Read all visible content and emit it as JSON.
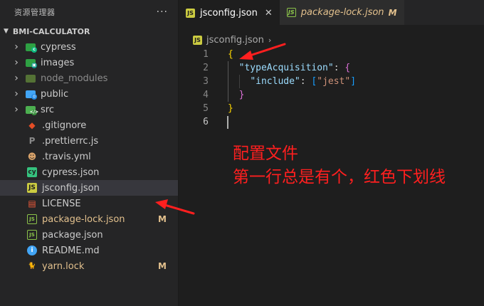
{
  "sidebar": {
    "title": "资源管理器",
    "more": "···",
    "section": "BMI-CALCULATOR",
    "items": [
      {
        "label": "cypress",
        "kind": "folder",
        "icon": "cypress-folder-icon",
        "color": "#2ea043",
        "mini": "c",
        "mini_color": "#10b981",
        "dim": false
      },
      {
        "label": "images",
        "kind": "folder",
        "icon": "images-folder-icon",
        "color": "#2ea043",
        "mini": "▣",
        "mini_color": "#0d9488",
        "dim": false
      },
      {
        "label": "node_modules",
        "kind": "folder",
        "icon": "node-modules-folder-icon",
        "color": "#7cb342",
        "mini": "",
        "mini_color": "#8bc34a",
        "dim": true
      },
      {
        "label": "public",
        "kind": "folder",
        "icon": "public-folder-icon",
        "color": "#42a5f5",
        "mini": "◎",
        "mini_color": "#1e88e5",
        "dim": false
      },
      {
        "label": "src",
        "kind": "folder",
        "icon": "src-folder-icon",
        "color": "#4caf50",
        "mini": "</>",
        "mini_color": "#388e3c",
        "dim": false
      },
      {
        "label": ".gitignore",
        "kind": "file",
        "icon": "git-icon",
        "glyph": "◆",
        "color": "#e44d26",
        "fg": "#e44d26",
        "bg": "transparent"
      },
      {
        "label": ".prettierrc.js",
        "kind": "file",
        "icon": "prettier-icon",
        "glyph": "P",
        "color": "#8a8a8a",
        "fg": "#8a8a8a",
        "bg": "transparent"
      },
      {
        "label": ".travis.yml",
        "kind": "file",
        "icon": "travis-icon",
        "glyph": "☻",
        "color": "#cd5c3a",
        "fg": "#d9a36a",
        "bg": "transparent"
      },
      {
        "label": "cypress.json",
        "kind": "file",
        "icon": "cypress-icon",
        "glyph": "cy",
        "color": "#35c27e",
        "fg": "#1e1e1e",
        "bg": "#35c27e"
      },
      {
        "label": "jsconfig.json",
        "kind": "file",
        "icon": "js-config-icon",
        "glyph": "JS",
        "color": "#cbcb41",
        "fg": "#1e1e1e",
        "bg": "#cbcb41",
        "selected": true
      },
      {
        "label": "LICENSE",
        "kind": "file",
        "icon": "license-icon",
        "glyph": "▤",
        "color": "#ef5a3a",
        "fg": "#ef5a3a",
        "bg": "transparent"
      },
      {
        "label": "package-lock.json",
        "kind": "file",
        "icon": "npm-lock-icon",
        "glyph": "JS",
        "color": "#8bc34a",
        "fg": "#8bc34a",
        "bg": "transparent",
        "modified": true,
        "badge": "M"
      },
      {
        "label": "package.json",
        "kind": "file",
        "icon": "npm-icon",
        "glyph": "JS",
        "color": "#8bc34a",
        "fg": "#8bc34a",
        "bg": "transparent"
      },
      {
        "label": "README.md",
        "kind": "file",
        "icon": "info-icon",
        "glyph": "i",
        "color": "#42a5f5",
        "fg": "#ffffff",
        "bg": "#42a5f5",
        "round": true
      },
      {
        "label": "yarn.lock",
        "kind": "file",
        "icon": "yarn-icon",
        "glyph": "🐈",
        "color": "#2c8ebb",
        "fg": "#2c8ebb",
        "bg": "transparent",
        "modified": true,
        "badge": "M"
      }
    ]
  },
  "tabs": [
    {
      "label": "jsconfig.json",
      "icon": "JS",
      "active": true,
      "close": "✕"
    },
    {
      "label": "package-lock.json",
      "icon": "JS",
      "active": false,
      "badge": "M"
    }
  ],
  "breadcrumb": {
    "icon": "JS",
    "file": "jsconfig.json",
    "sep": "›"
  },
  "editor": {
    "line_numbers": [
      "1",
      "2",
      "3",
      "4",
      "5",
      "6"
    ],
    "active_line": "6"
  },
  "code": {
    "l1_open": "{",
    "l2_key": "\"typeAcquisition\"",
    "l2_colon": ": ",
    "l2_open": "{",
    "l3_key": "\"include\"",
    "l3_colon": ": ",
    "l3_open": "[",
    "l3_val": "\"jest\"",
    "l3_close": "]",
    "l4_close": "}",
    "l5_close": "}"
  },
  "annotation": {
    "line1": "配置文件",
    "line2": "第一行总是有个，红色下划线"
  },
  "colors": {
    "annotation_red": "#ff1f1f",
    "modified": "#e2c08d",
    "bracket_level1": "#ffd700",
    "bracket_level2": "#da70d6",
    "bracket_level3": "#179fff"
  }
}
